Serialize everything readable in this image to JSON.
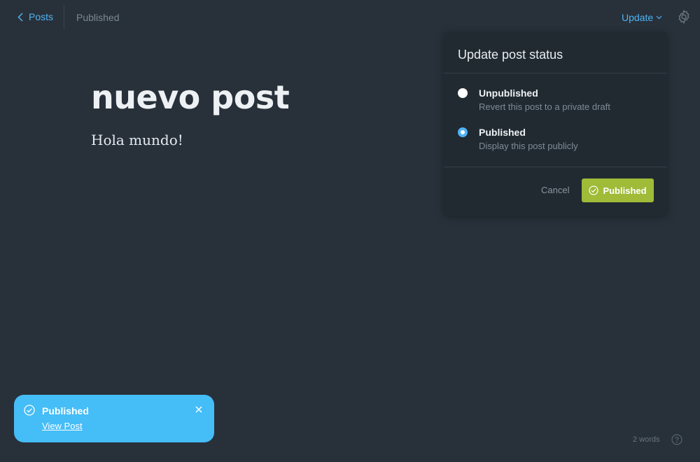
{
  "header": {
    "back_label": "Posts",
    "status": "Published",
    "update_label": "Update"
  },
  "editor": {
    "title": "nuevo post",
    "body": "Hola mundo!"
  },
  "popover": {
    "title": "Update post status",
    "options": [
      {
        "label": "Unpublished",
        "description": "Revert this post to a private draft",
        "selected": false
      },
      {
        "label": "Published",
        "description": "Display this post publicly",
        "selected": true
      }
    ],
    "cancel_label": "Cancel",
    "confirm_label": "Published"
  },
  "toast": {
    "title": "Published",
    "link_label": "View Post"
  },
  "footer": {
    "word_count": "2 words"
  },
  "colors": {
    "background": "#28313a",
    "accent": "#4fb3f5",
    "publish_green": "#9fbb38",
    "toast_blue": "#45bdf7"
  },
  "icons": [
    "chevron-left-icon",
    "chevron-down-icon",
    "gear-icon",
    "check-circle-icon",
    "close-icon",
    "help-icon"
  ]
}
